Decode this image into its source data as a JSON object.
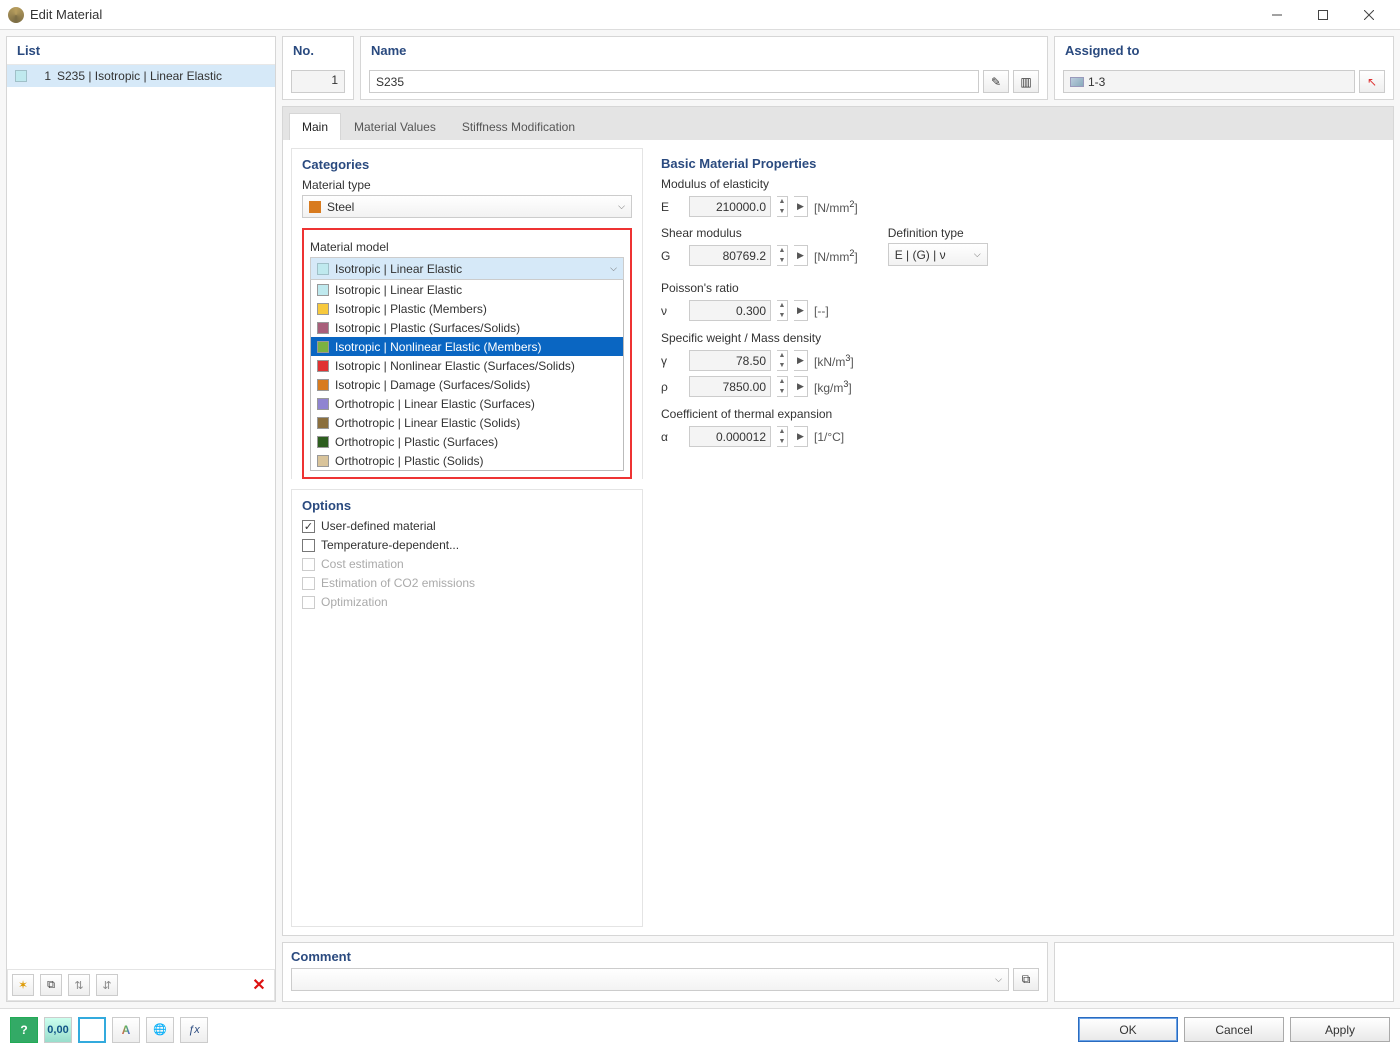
{
  "window": {
    "title": "Edit Material"
  },
  "list": {
    "header": "List",
    "items": [
      {
        "num": "1",
        "label": "S235 | Isotropic | Linear Elastic"
      }
    ]
  },
  "no": {
    "header": "No.",
    "value": "1"
  },
  "name": {
    "header": "Name",
    "value": "S235"
  },
  "assigned": {
    "header": "Assigned to",
    "value": "1-3"
  },
  "tabs": {
    "main": "Main",
    "mv": "Material Values",
    "sm": "Stiffness Modification"
  },
  "categories": {
    "header": "Categories",
    "type_label": "Material type",
    "type_value": "Steel",
    "model_label": "Material model",
    "model_value": "Isotropic | Linear Elastic",
    "models": [
      "Isotropic | Linear Elastic",
      "Isotropic | Plastic (Members)",
      "Isotropic | Plastic (Surfaces/Solids)",
      "Isotropic | Nonlinear Elastic (Members)",
      "Isotropic | Nonlinear Elastic (Surfaces/Solids)",
      "Isotropic | Damage (Surfaces/Solids)",
      "Orthotropic | Linear Elastic (Surfaces)",
      "Orthotropic | Linear Elastic (Solids)",
      "Orthotropic | Plastic (Surfaces)",
      "Orthotropic | Plastic (Solids)"
    ]
  },
  "options": {
    "header": "Options",
    "user": "User-defined material",
    "temp": "Temperature-dependent...",
    "cost": "Cost estimation",
    "co2": "Estimation of CO2 emissions",
    "opt": "Optimization"
  },
  "props": {
    "header": "Basic Material Properties",
    "E_label": "Modulus of elasticity",
    "E_sym": "E",
    "E_val": "210000.0",
    "E_unit": "[N/mm²]",
    "G_label": "Shear modulus",
    "G_sym": "G",
    "G_val": "80769.2",
    "G_unit": "[N/mm²]",
    "def_label": "Definition type",
    "def_val": "E | (G) | ν",
    "nu_label": "Poisson's ratio",
    "nu_sym": "ν",
    "nu_val": "0.300",
    "nu_unit": "[--]",
    "sw_label": "Specific weight / Mass density",
    "gamma_sym": "γ",
    "gamma_val": "78.50",
    "gamma_unit": "[kN/m³]",
    "rho_sym": "ρ",
    "rho_val": "7850.00",
    "rho_unit": "[kg/m³]",
    "alpha_label": "Coefficient of thermal expansion",
    "alpha_sym": "α",
    "alpha_val": "0.000012",
    "alpha_unit": "[1/°C]"
  },
  "comment": {
    "header": "Comment"
  },
  "buttons": {
    "ok": "OK",
    "cancel": "Cancel",
    "apply": "Apply"
  }
}
